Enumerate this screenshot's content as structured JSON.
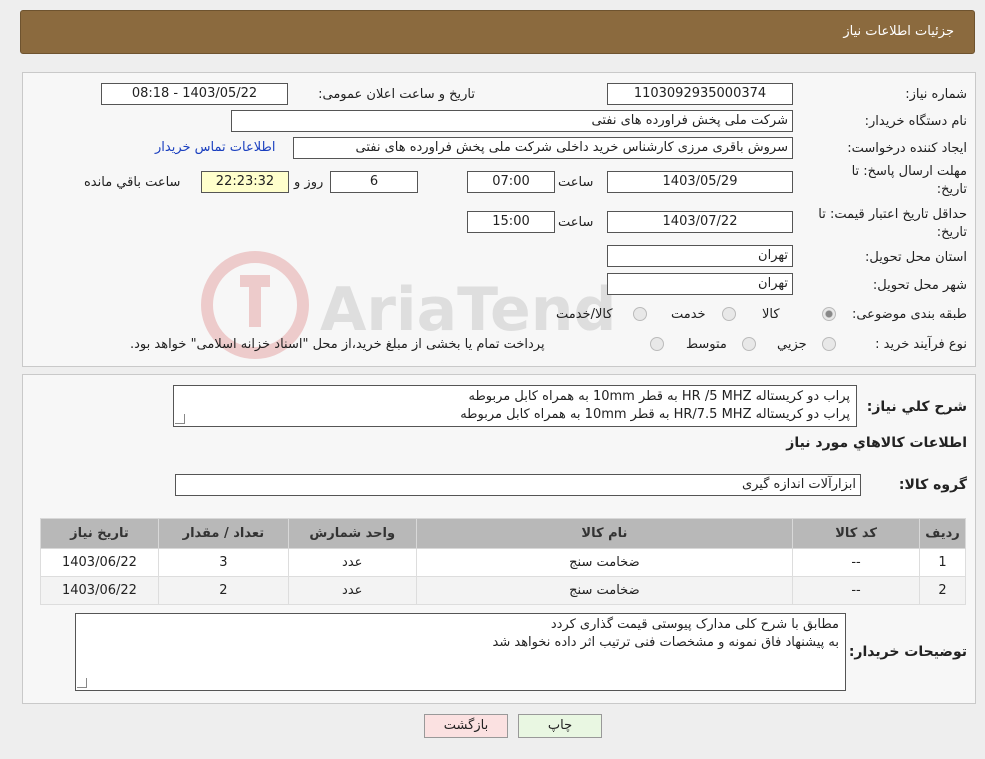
{
  "header": {
    "title": "جزئیات اطلاعات نیاز"
  },
  "watermark": {
    "text": "AriaTender.neT"
  },
  "form": {
    "need_number_label": "شماره نیاز:",
    "need_number": "1103092935000374",
    "announce_label": "تاریخ و ساعت اعلان عمومی:",
    "announce_value": "1403/05/22 - 08:18",
    "buyer_org_label": "نام دستگاه خریدار:",
    "buyer_org": "شرکت ملی پخش فراورده های نفتی",
    "creator_label": "ایجاد کننده درخواست:",
    "creator": "سروش باقری مرزی کارشناس خرید داخلی شرکت ملی پخش فراورده های نفتی",
    "contact_link": "اطلاعات تماس خریدار",
    "deadline_label_1": "مهلت ارسال پاسخ: تا",
    "deadline_label_2": "تاریخ:",
    "deadline_date": "1403/05/29",
    "time_label": "ساعت",
    "deadline_time": "07:00",
    "days": "6",
    "days_label": "روز و",
    "remaining": "22:23:32",
    "remaining_label": "ساعت باقي مانده",
    "validity_label_1": "حداقل تاریخ اعتبار قیمت: تا",
    "validity_label_2": "تاریخ:",
    "validity_date": "1403/07/22",
    "validity_time": "15:00",
    "province_label": "استان محل تحویل:",
    "province": "تهران",
    "city_label": "شهر محل تحویل:",
    "city": "تهران",
    "category_label": "طبقه بندی موضوعی:",
    "category_options": [
      "کالا",
      "خدمت",
      "کالا/خدمت"
    ],
    "process_label": "نوع فرآیند خرید :",
    "process_options": [
      "جزيي",
      "متوسط"
    ],
    "process_note": "پرداخت تمام یا بخشی از مبلغ خرید،از محل \"اسناد خزانه اسلامی\" خواهد بود."
  },
  "details": {
    "summary_label": "شرح کلي نياز:",
    "summary_line1": "پراب دو کریستاله  HR /5 MHZ به قطر 10mm به همراه کابل مربوطه",
    "summary_line2": "پراب دو کریستاله  HR/7.5 MHZ به قطر 10mm به همراه کابل مربوطه",
    "goods_info_title": "اطلاعات کالاهاي مورد نياز",
    "group_label": "گروه کالا:",
    "group_value": "ابزارآلات اندازه گیری",
    "table": {
      "headers": [
        "رديف",
        "کد کالا",
        "نام کالا",
        "واحد شمارش",
        "تعداد / مقدار",
        "تاريخ نياز"
      ],
      "rows": [
        [
          "1",
          "--",
          "ضخامت سنج",
          "عدد",
          "3",
          "1403/06/22"
        ],
        [
          "2",
          "--",
          "ضخامت سنج",
          "عدد",
          "2",
          "1403/06/22"
        ]
      ]
    },
    "buyer_notes_label": "توضیحات خریدار:",
    "buyer_notes_line1": "مطابق با  شرح کلی مدارک پیوستی قیمت گذاری کردد",
    "buyer_notes_line2": " به پیشنهاد فاق نمونه و مشخصات فنی ترتیب اثر داده نخواهد شد"
  },
  "buttons": {
    "print": "چاپ",
    "back": "بازگشت"
  }
}
